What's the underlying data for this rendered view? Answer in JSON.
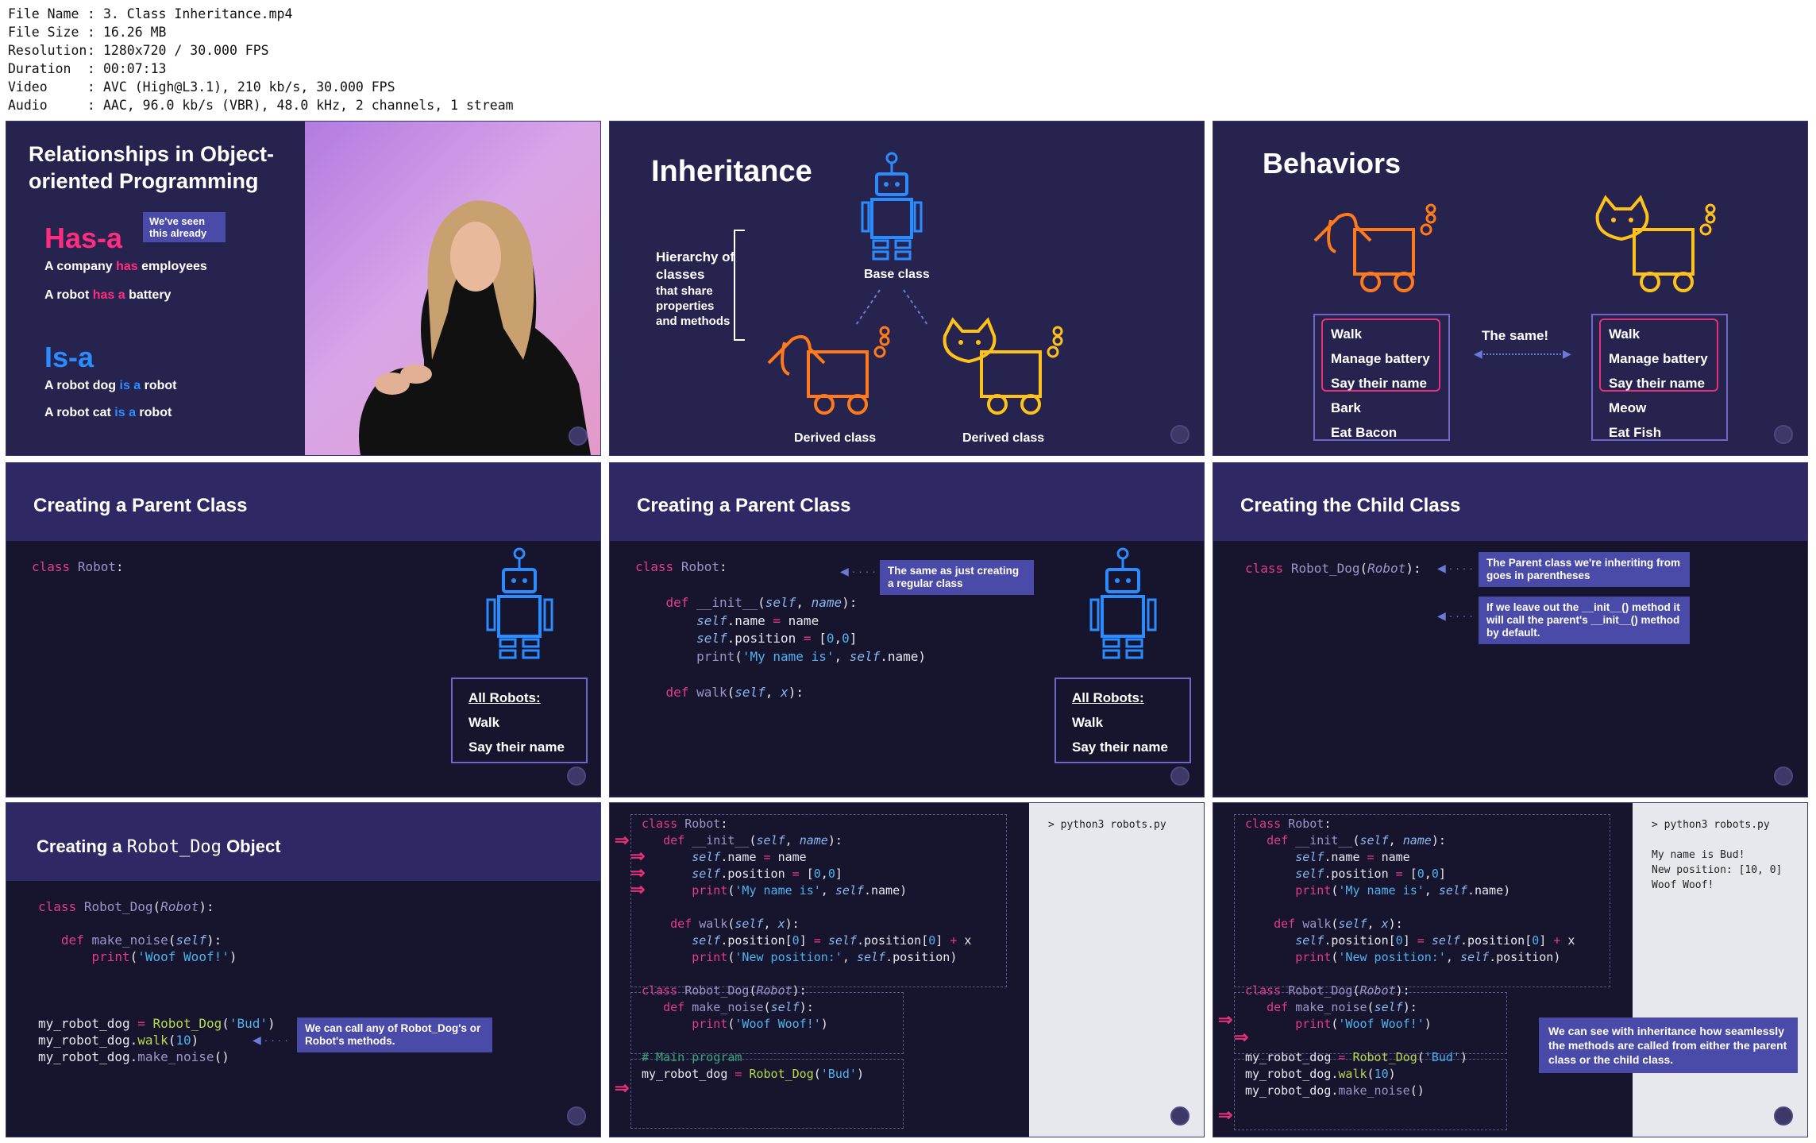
{
  "meta": [
    {
      "k": "File Name",
      "v": "3. Class Inheritance.mp4"
    },
    {
      "k": "File Size",
      "v": "16.26 MB"
    },
    {
      "k": "Resolution",
      "v": "1280x720 / 30.000 FPS"
    },
    {
      "k": "Duration",
      "v": "00:07:13"
    },
    {
      "k": "Video",
      "v": "AVC (High@L3.1), 210 kb/s, 30.000 FPS"
    },
    {
      "k": "Audio",
      "v": "AAC, 96.0 kb/s (VBR), 48.0 kHz, 2 channels, 1 stream"
    }
  ],
  "t1": {
    "title": "Relationships in Object-oriented Programming",
    "hasa": "Has-a",
    "badge": "We've seen this already",
    "line1": [
      "A company ",
      "has",
      " employees"
    ],
    "line2": [
      "A robot ",
      "has a",
      " battery"
    ],
    "isa": "Is-a",
    "line3": [
      "A robot dog ",
      "is a",
      " robot"
    ],
    "line4": [
      "A robot cat ",
      "is a",
      " robot"
    ]
  },
  "t2": {
    "title": "Inheritance",
    "hier_bold": "Hierarchy of classes",
    "hier_rest": "that share properties and methods",
    "base": "Base class",
    "derived1": "Derived class",
    "derived2": "Derived class"
  },
  "t3": {
    "title": "Behaviors",
    "same": "The same!",
    "left": [
      "Walk",
      "Manage battery",
      "Say their name",
      "Bark",
      "Eat Bacon"
    ],
    "right": [
      "Walk",
      "Manage battery",
      "Say their name",
      "Meow",
      "Eat Fish"
    ]
  },
  "t4": {
    "title": "Creating a Parent Class",
    "list_head": "All Robots:",
    "list": [
      "Walk",
      "Say their name"
    ]
  },
  "t5": {
    "title": "Creating a Parent Class",
    "callout": "The same as just creating a regular class",
    "list_head": "All Robots:",
    "list": [
      "Walk",
      "Say their name"
    ]
  },
  "t6": {
    "title": "Creating the Child Class",
    "callout1": "The Parent class we're inheriting from goes in parentheses",
    "callout2": "If we leave out the __init__() method it will call the parent's __init__() method by default."
  },
  "t7": {
    "title_a": "Creating a",
    "title_b": "Robot_Dog",
    "title_c": "Object",
    "callout": "We can call any of Robot_Dog's or Robot's methods."
  },
  "t8": {
    "terminal": "> python3 robots.py",
    "comment": "# Main program"
  },
  "t9": {
    "terminal": "> python3 robots.py",
    "out": [
      "My name is Bud!",
      "New position: [10, 0]",
      "Woof Woof!"
    ],
    "callout": "We can see with inheritance how seamlessly the methods are called from either the parent class or the child class."
  },
  "colors": {
    "accent_pink": "#ff2d7e",
    "accent_blue": "#2a8cff",
    "bg": "#27234f"
  }
}
